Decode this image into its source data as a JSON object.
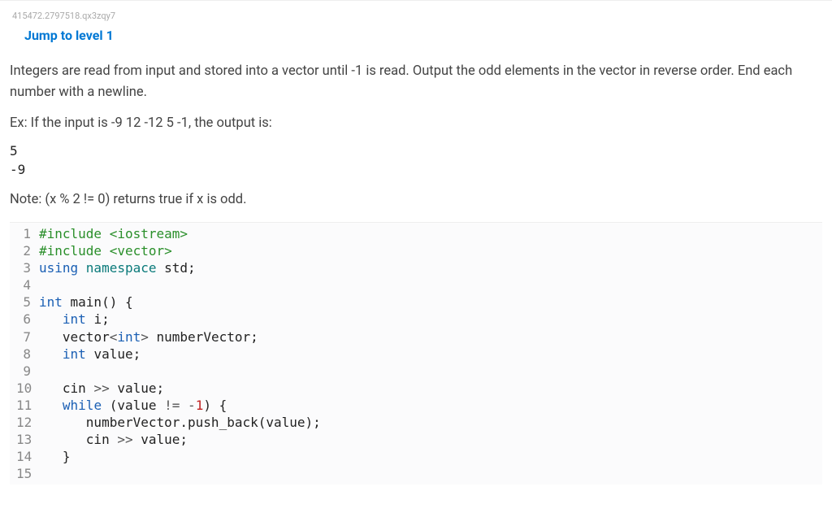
{
  "meta": {
    "question_id": "415472.2797518.qx3zqy7"
  },
  "link": {
    "jump_label": "Jump to level 1"
  },
  "problem": {
    "description": "Integers are read from input and stored into a vector until -1 is read. Output the odd elements in the vector in reverse order. End each number with a newline.",
    "example_intro": "Ex: If the input is -9 12 -12 5 -1, the output is:",
    "sample_output_line1": "5",
    "sample_output_line2": "-9",
    "note": "Note: (x % 2 != 0) returns true if x is odd."
  },
  "code": {
    "lines": [
      {
        "n": "1",
        "tokens": [
          [
            "#include ",
            "kw-green"
          ],
          [
            "<iostream>",
            "kw-green"
          ]
        ]
      },
      {
        "n": "2",
        "tokens": [
          [
            "#include ",
            "kw-green"
          ],
          [
            "<vector>",
            "kw-green"
          ]
        ]
      },
      {
        "n": "3",
        "tokens": [
          [
            "using ",
            "kw-blue"
          ],
          [
            "namespace ",
            "kw-teal"
          ],
          [
            "std",
            "ident"
          ],
          [
            ";",
            "punct"
          ]
        ]
      },
      {
        "n": "4",
        "tokens": []
      },
      {
        "n": "5",
        "tokens": [
          [
            "int ",
            "kw-blue"
          ],
          [
            "main",
            "ident"
          ],
          [
            "() {",
            "punct"
          ]
        ]
      },
      {
        "n": "6",
        "tokens": [
          [
            "   ",
            ""
          ],
          [
            "int ",
            "kw-blue"
          ],
          [
            "i",
            "ident"
          ],
          [
            ";",
            "punct"
          ]
        ]
      },
      {
        "n": "7",
        "tokens": [
          [
            "   ",
            ""
          ],
          [
            "vector",
            "ident"
          ],
          [
            "<",
            "op"
          ],
          [
            "int",
            "kw-blue"
          ],
          [
            "> ",
            "op"
          ],
          [
            "numberVector",
            "ident"
          ],
          [
            ";",
            "punct"
          ]
        ]
      },
      {
        "n": "8",
        "tokens": [
          [
            "   ",
            ""
          ],
          [
            "int ",
            "kw-blue"
          ],
          [
            "value",
            "ident"
          ],
          [
            ";",
            "punct"
          ]
        ]
      },
      {
        "n": "9",
        "tokens": []
      },
      {
        "n": "10",
        "tokens": [
          [
            "   ",
            ""
          ],
          [
            "cin ",
            "ident"
          ],
          [
            ">> ",
            "op"
          ],
          [
            "value",
            "ident"
          ],
          [
            ";",
            "punct"
          ]
        ]
      },
      {
        "n": "11",
        "tokens": [
          [
            "   ",
            ""
          ],
          [
            "while ",
            "kw-blue"
          ],
          [
            "(",
            "punct"
          ],
          [
            "value ",
            "ident"
          ],
          [
            "!= ",
            "op"
          ],
          [
            "-",
            "op"
          ],
          [
            "1",
            "num"
          ],
          [
            ") {",
            "punct"
          ]
        ]
      },
      {
        "n": "12",
        "tokens": [
          [
            "      ",
            ""
          ],
          [
            "numberVector",
            "ident"
          ],
          [
            ".",
            "punct"
          ],
          [
            "push_back",
            "ident"
          ],
          [
            "(",
            "punct"
          ],
          [
            "value",
            "ident"
          ],
          [
            ");",
            "punct"
          ]
        ]
      },
      {
        "n": "13",
        "tokens": [
          [
            "      ",
            ""
          ],
          [
            "cin ",
            "ident"
          ],
          [
            ">> ",
            "op"
          ],
          [
            "value",
            "ident"
          ],
          [
            ";",
            "punct"
          ]
        ]
      },
      {
        "n": "14",
        "tokens": [
          [
            "   ",
            ""
          ],
          [
            "}",
            "punct"
          ]
        ]
      },
      {
        "n": "15",
        "tokens": []
      }
    ]
  }
}
